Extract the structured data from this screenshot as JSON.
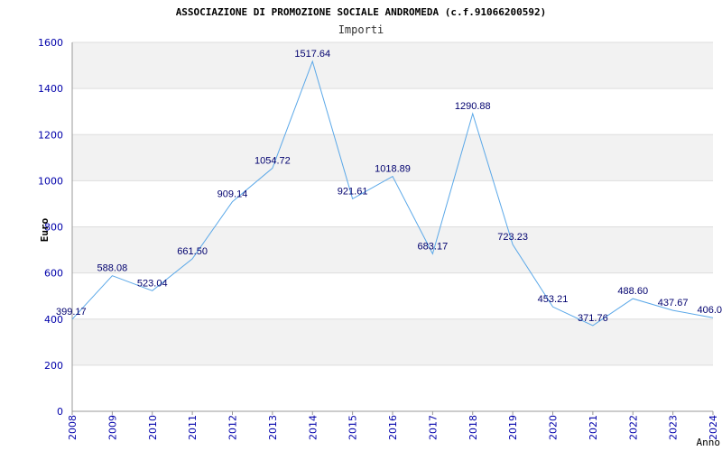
{
  "chart_data": {
    "type": "line",
    "title": "ASSOCIAZIONE DI PROMOZIONE SOCIALE ANDROMEDA (c.f.91066200592)",
    "subtitle": "Importi",
    "xlabel": "Anno",
    "ylabel": "Euro",
    "ylim": [
      0,
      1600
    ],
    "yticks": [
      0,
      200,
      400,
      600,
      800,
      1000,
      1200,
      1400,
      1600
    ],
    "grid": true,
    "x": [
      "2008",
      "2009",
      "2010",
      "2011",
      "2012",
      "2013",
      "2014",
      "2015",
      "2016",
      "2017",
      "2018",
      "2019",
      "2020",
      "2021",
      "2022",
      "2023",
      "2024"
    ],
    "values": [
      399.17,
      588.08,
      523.04,
      661.5,
      909.14,
      1054.72,
      1517.64,
      921.61,
      1018.89,
      683.17,
      1290.88,
      723.23,
      453.21,
      371.76,
      488.6,
      437.67,
      406.0
    ],
    "value_labels": [
      "399.17",
      "588.08",
      "523.04",
      "661.50",
      "909.14",
      "1054.72",
      "1517.64",
      "921.61",
      "1018.89",
      "683.17",
      "1290.88",
      "723.23",
      "453.21",
      "371.76",
      "488.60",
      "437.67",
      "406.0"
    ],
    "colors": {
      "line": "#5ba8e8",
      "band": "#f2f2f2",
      "gridline": "#dddddd",
      "tick_label": "#0000aa",
      "value_label": "#00006e",
      "axis": "#999999"
    }
  }
}
